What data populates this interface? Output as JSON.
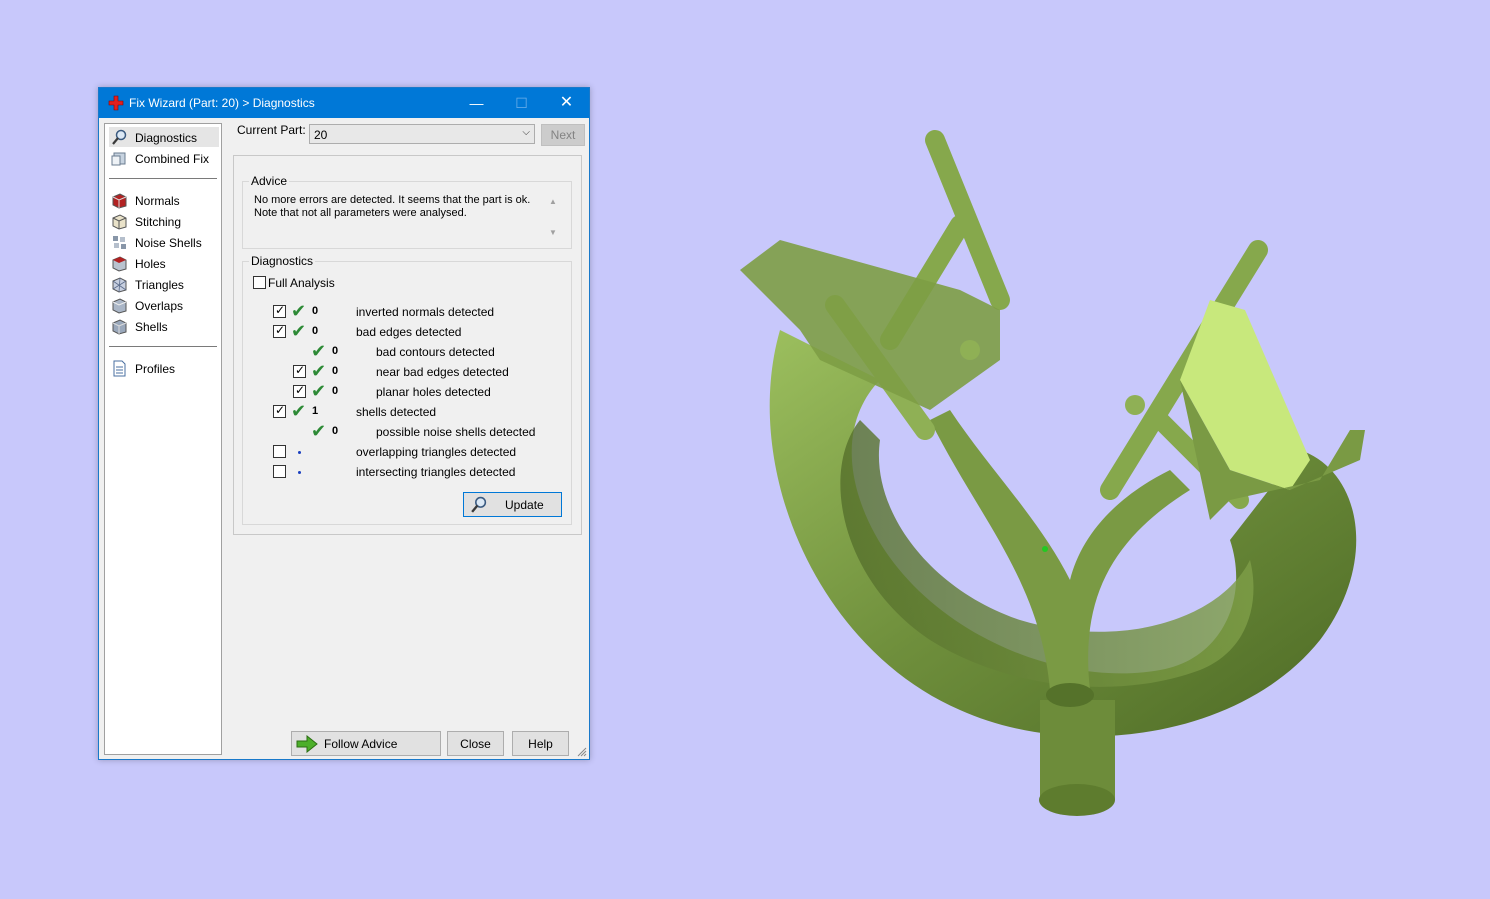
{
  "window": {
    "title": "Fix Wizard (Part: 20) > Diagnostics",
    "controls": {
      "minimize": "—",
      "maximize": "☐",
      "close": "✕"
    }
  },
  "nav": {
    "top": [
      {
        "label": "Diagnostics",
        "icon": "magnifier-icon",
        "selected": true
      },
      {
        "label": "Combined Fix",
        "icon": "combined-fix-icon",
        "selected": false
      }
    ],
    "tools": [
      {
        "label": "Normals",
        "icon": "normals-icon"
      },
      {
        "label": "Stitching",
        "icon": "stitching-icon"
      },
      {
        "label": "Noise Shells",
        "icon": "noise-shells-icon"
      },
      {
        "label": "Holes",
        "icon": "holes-icon"
      },
      {
        "label": "Triangles",
        "icon": "triangles-icon"
      },
      {
        "label": "Overlaps",
        "icon": "overlaps-icon"
      },
      {
        "label": "Shells",
        "icon": "shells-icon"
      }
    ],
    "bottom": [
      {
        "label": "Profiles",
        "icon": "profiles-icon"
      }
    ]
  },
  "current_part": {
    "label": "Current Part:",
    "value": "20",
    "next_label": "Next"
  },
  "advice": {
    "heading": "Advice",
    "line1": "No more errors are detected. It seems that the part is ok.",
    "line2": "Note that not all parameters were analysed."
  },
  "diagnostics": {
    "heading": "Diagnostics",
    "full_analysis_label": "Full Analysis",
    "rows": [
      {
        "label": "inverted normals detected",
        "count": "0",
        "checked": true,
        "ok": true,
        "indent": false
      },
      {
        "label": "bad edges detected",
        "count": "0",
        "checked": true,
        "ok": true,
        "indent": false
      },
      {
        "label": "bad contours detected",
        "count": "0",
        "checked": null,
        "ok": true,
        "indent": true
      },
      {
        "label": "near bad edges detected",
        "count": "0",
        "checked": true,
        "ok": true,
        "indent": true
      },
      {
        "label": "planar holes detected",
        "count": "0",
        "checked": true,
        "ok": true,
        "indent": true
      },
      {
        "label": "shells detected",
        "count": "1",
        "checked": true,
        "ok": true,
        "indent": false
      },
      {
        "label": "possible noise shells detected",
        "count": "0",
        "checked": null,
        "ok": true,
        "indent": true
      },
      {
        "label": "overlapping triangles detected",
        "count": "",
        "checked": false,
        "ok": false,
        "indent": false
      },
      {
        "label": "intersecting triangles detected",
        "count": "",
        "checked": false,
        "ok": false,
        "indent": false
      }
    ],
    "update_label": "Update"
  },
  "footer": {
    "follow_label": "Follow Advice",
    "close_label": "Close",
    "help_label": "Help"
  },
  "colors": {
    "titlebar": "#0078d7",
    "background": "#c8c8fb",
    "model": "#7a9a44",
    "ok_check": "#2d8a36"
  }
}
